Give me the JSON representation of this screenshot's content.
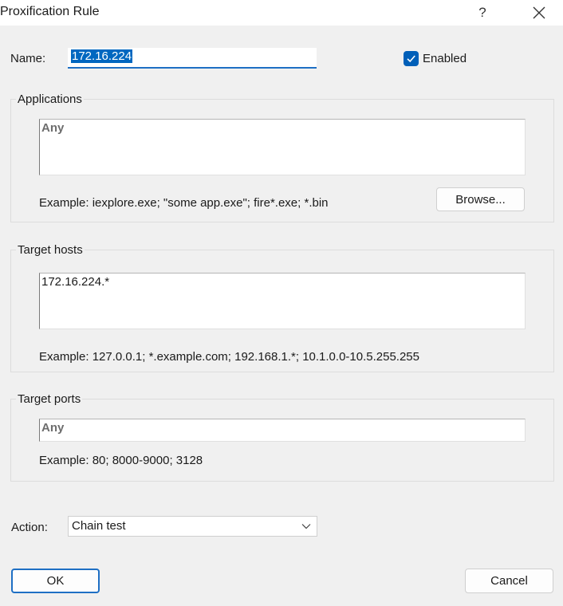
{
  "window": {
    "title": "Proxification Rule",
    "help_label": "?"
  },
  "name": {
    "label": "Name:",
    "value": "172.16.224"
  },
  "enabled": {
    "label": "Enabled",
    "checked": true
  },
  "applications": {
    "title": "Applications",
    "value": "Any",
    "example": "Example: iexplore.exe; \"some app.exe\"; fire*.exe; *.bin",
    "browse_label": "Browse..."
  },
  "target_hosts": {
    "title": "Target hosts",
    "value": "172.16.224.*",
    "example": "Example: 127.0.0.1; *.example.com; 192.168.1.*; 10.1.0.0-10.5.255.255"
  },
  "target_ports": {
    "title": "Target ports",
    "value": "Any",
    "example": "Example: 80; 8000-9000; 3128"
  },
  "action": {
    "label": "Action:",
    "value": "Chain test"
  },
  "buttons": {
    "ok": "OK",
    "cancel": "Cancel"
  },
  "colors": {
    "accent": "#005fb8",
    "focus": "#1e6fc4"
  }
}
